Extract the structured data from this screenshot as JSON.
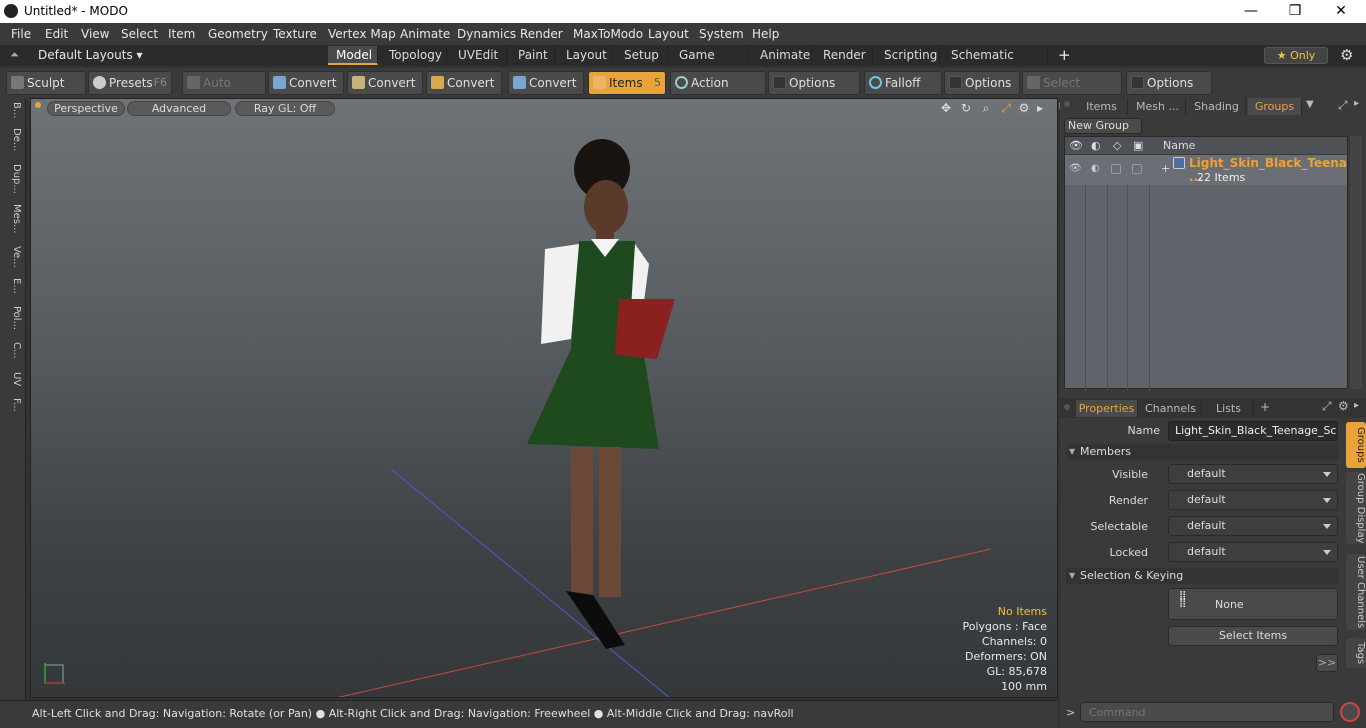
{
  "window": {
    "title": "Untitled* - MODO",
    "minimize": "—",
    "maximize": "❐",
    "close": "✕"
  },
  "menu": [
    "File",
    "Edit",
    "View",
    "Select",
    "Item",
    "Geometry",
    "Texture",
    "Vertex Map",
    "Animate",
    "Dynamics",
    "Render",
    "MaxToModo",
    "Layout",
    "System",
    "Help"
  ],
  "layouts": {
    "selector": "Default Layouts ▾",
    "tabs": [
      "Model",
      "Topology",
      "UVEdit",
      "Paint",
      "Layout",
      "Setup",
      "Game Tools",
      "Animate",
      "Render",
      "Scripting",
      "Schematic Fusion"
    ],
    "active": "Model",
    "add": "+",
    "only": "★ Only"
  },
  "toolbar": {
    "sculpt": "Sculpt",
    "presets": "Presets",
    "presets_key": "F6",
    "auto_select": "Auto Select",
    "convert1": "Convert",
    "convert2": "Convert",
    "convert3": "Convert",
    "convert4": "Convert",
    "items": "Items",
    "items_key": "5",
    "action_center": "Action Center",
    "options1": "Options",
    "falloff": "Falloff",
    "options2": "Options",
    "select_through": "Select Through",
    "options3": "Options"
  },
  "left_tabs": [
    "B...",
    "De...",
    "Dup...",
    "Mes...",
    "Ve...",
    "E...",
    "Pol...",
    "C...",
    "UV",
    "F..."
  ],
  "viewport": {
    "mode": "Perspective",
    "shading": "Advanced",
    "raygl": "Ray GL: Off",
    "stats": {
      "no_items": "No Items",
      "polygons": "Polygons : Face",
      "channels": "Channels: 0",
      "deformers": "Deformers: ON",
      "gl": "GL: 85,678",
      "scale": "100 mm"
    }
  },
  "status": "Alt-Left Click and Drag: Navigation: Rotate (or Pan) ● Alt-Right Click and Drag: Navigation: Freewheel ● Alt-Middle Click and Drag: navRoll",
  "command_placeholder": "Command",
  "groups_panel": {
    "tabs": [
      "Items",
      "Mesh ...",
      "Shading",
      "Groups"
    ],
    "active": "Groups",
    "new_group": "New Group",
    "name_col": "Name",
    "group_name": "Light_Skin_Black_Teena ...",
    "group_count": "22 Items"
  },
  "properties": {
    "tabs": [
      "Properties",
      "Channels",
      "Lists"
    ],
    "add": "+",
    "name_label": "Name",
    "name_value": "Light_Skin_Black_Teenage_Schoo",
    "members": "Members",
    "visible_label": "Visible",
    "visible": "default",
    "render_label": "Render",
    "render": "default",
    "selectable_label": "Selectable",
    "selectable": "default",
    "locked_label": "Locked",
    "locked": "default",
    "selection_keying": "Selection & Keying",
    "none": "None",
    "select_items": "Select Items",
    "more": ">>",
    "side_tabs": [
      "Groups",
      "Group Display",
      "User Channels",
      "Tags"
    ]
  },
  "colors": {
    "accent": "#e8a33a",
    "group_name": "#f0a030"
  }
}
